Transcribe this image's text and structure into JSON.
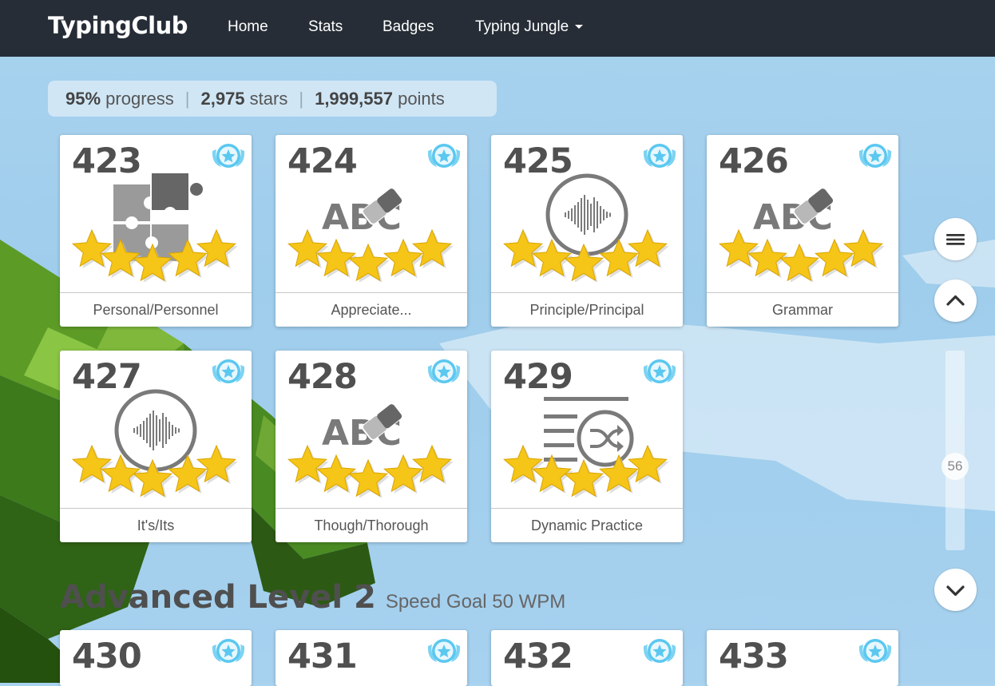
{
  "navbar": {
    "brand": "TypingClub",
    "items": [
      {
        "label": "Home"
      },
      {
        "label": "Stats"
      },
      {
        "label": "Badges"
      },
      {
        "label": "Typing Jungle"
      }
    ]
  },
  "summary": {
    "progress_value": "95%",
    "progress_label": "progress",
    "stars_value": "2,975",
    "stars_label": "stars",
    "points_value": "1,999,557",
    "points_label": "points"
  },
  "lessons": [
    {
      "number": "423",
      "label": "Personal/Personnel",
      "icon": "puzzle-icon",
      "stars": 5
    },
    {
      "number": "424",
      "label": "Appreciate...",
      "icon": "abc-eraser-icon",
      "stars": 5
    },
    {
      "number": "425",
      "label": "Principle/Principal",
      "icon": "audio-wave-icon",
      "stars": 5
    },
    {
      "number": "426",
      "label": "Grammar",
      "icon": "abc-eraser-icon",
      "stars": 5
    },
    {
      "number": "427",
      "label": "It's/Its",
      "icon": "audio-wave-icon",
      "stars": 5
    },
    {
      "number": "428",
      "label": "Though/Thorough",
      "icon": "abc-eraser-icon",
      "stars": 5
    },
    {
      "number": "429",
      "label": "Dynamic Practice",
      "icon": "shuffle-list-icon",
      "stars": 5
    }
  ],
  "section": {
    "title": "Advanced Level 2",
    "subtitle": "Speed Goal 50 WPM"
  },
  "next_lessons": [
    {
      "number": "430"
    },
    {
      "number": "431"
    },
    {
      "number": "432"
    },
    {
      "number": "433"
    }
  ],
  "icon_abc_text": "ABC",
  "scroll_position": "56",
  "colors": {
    "navbar": "#262d36",
    "star": "#f5c518",
    "badge": "#5bc8f0",
    "icon_gray": "#7a7a7a"
  }
}
